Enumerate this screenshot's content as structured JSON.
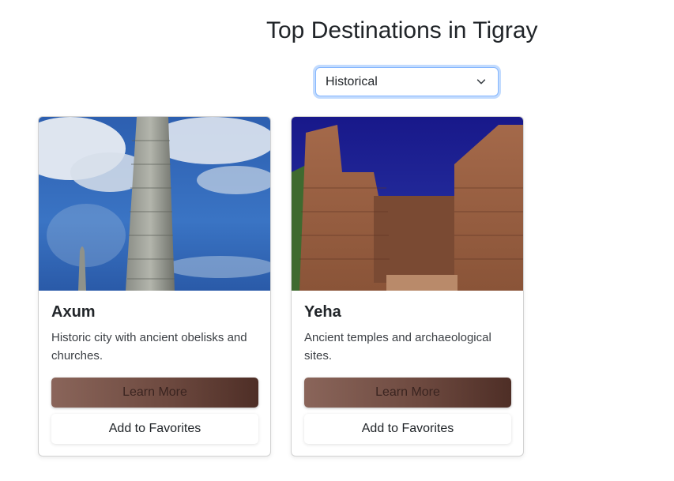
{
  "header": {
    "title": "Top Destinations in Tigray"
  },
  "filter": {
    "selected": "Historical",
    "icon": "chevron-down-icon"
  },
  "cards": [
    {
      "title": "Axum",
      "description": "Historic city with ancient obelisks and churches.",
      "learn_more_label": "Learn More",
      "favorites_label": "Add to Favorites",
      "image": "obelisk-photo"
    },
    {
      "title": "Yeha",
      "description": "Ancient temples and archaeological sites.",
      "learn_more_label": "Learn More",
      "favorites_label": "Add to Favorites",
      "image": "temple-ruins-photo"
    }
  ],
  "colors": {
    "learn_more_gradient": [
      "#8a655a",
      "#4e2e26"
    ],
    "select_focus": "#86b7fe"
  }
}
